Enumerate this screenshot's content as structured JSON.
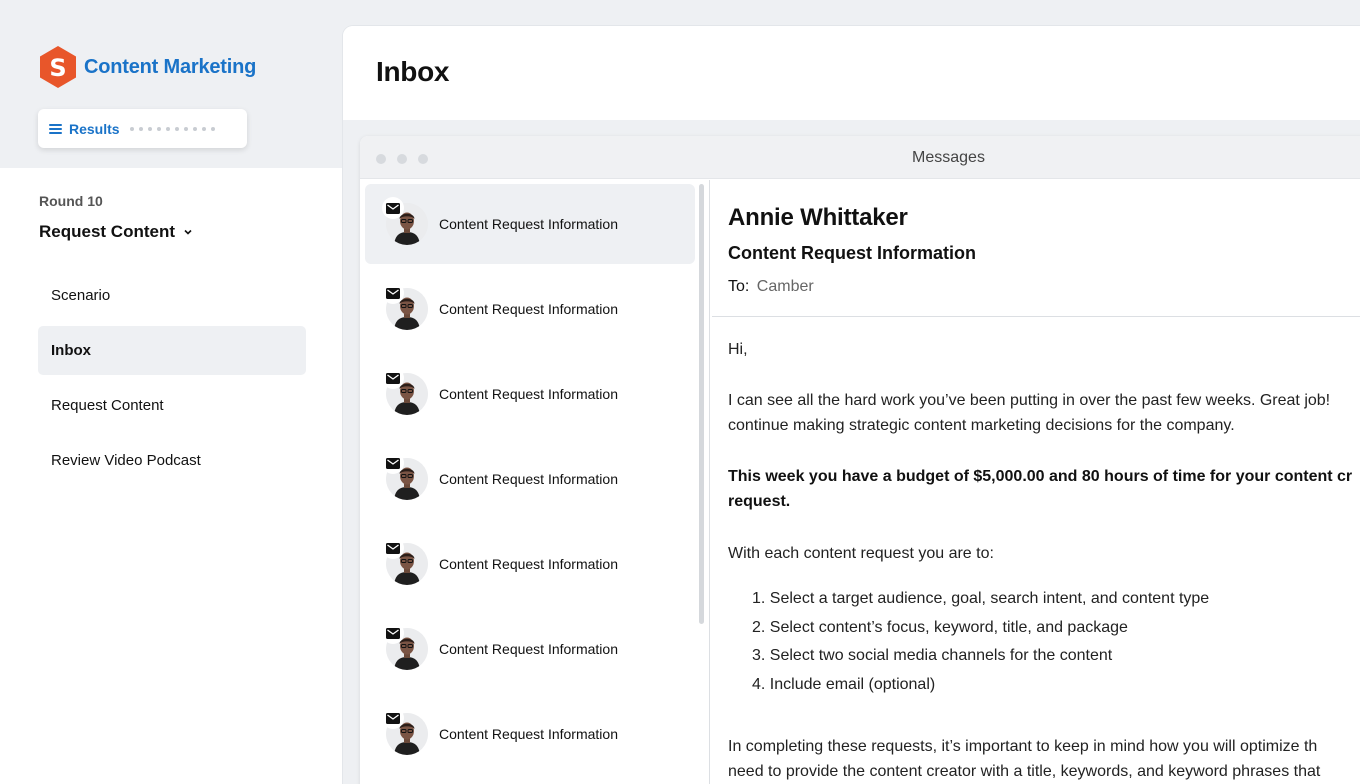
{
  "brand": {
    "title": "Content Marketing",
    "logo_letter": "S",
    "accent": "#1a73c8",
    "logo_color": "#e8562a"
  },
  "results": {
    "label": "Results",
    "icon": "menu-icon"
  },
  "sidebar": {
    "round_label": "Round 10",
    "section_title": "Request Content",
    "items": [
      {
        "label": "Scenario",
        "active": false
      },
      {
        "label": "Inbox",
        "active": true
      },
      {
        "label": "Request Content",
        "active": false
      },
      {
        "label": "Review Video Podcast",
        "active": false
      }
    ]
  },
  "page": {
    "title": "Inbox"
  },
  "window": {
    "title": "Messages"
  },
  "messages": [
    {
      "subject": "Content Request Information",
      "selected": true
    },
    {
      "subject": "Content Request Information",
      "selected": false
    },
    {
      "subject": "Content Request Information",
      "selected": false
    },
    {
      "subject": "Content Request Information",
      "selected": false
    },
    {
      "subject": "Content Request Information",
      "selected": false
    },
    {
      "subject": "Content Request Information",
      "selected": false
    },
    {
      "subject": "Content Request Information",
      "selected": false
    }
  ],
  "reader": {
    "sender": "Annie Whittaker",
    "subject": "Content Request Information",
    "to_label": "To:",
    "to_name": "Camber",
    "greeting": "Hi,",
    "para1_line1": "I can see all the hard work you’ve been putting in over the past few weeks. Great job!",
    "para1_line2": "continue making strategic content marketing decisions for the company.",
    "para2_line1": "This week you have a budget of $5,000.00 and 80 hours of time for your content cr",
    "para2_line2": "request.",
    "para3": "With each content request you are to:",
    "steps": [
      "1. Select a target audience, goal, search intent, and content type",
      "2. Select content’s focus, keyword, title, and package",
      "3. Select two social media channels for the content",
      "4. Include email (optional)"
    ],
    "para4_line1": "In completing these requests, it’s important to keep in mind how you will optimize th",
    "para4_line2": "need to provide the content creator with a title, keywords, and keyword phrases that"
  }
}
